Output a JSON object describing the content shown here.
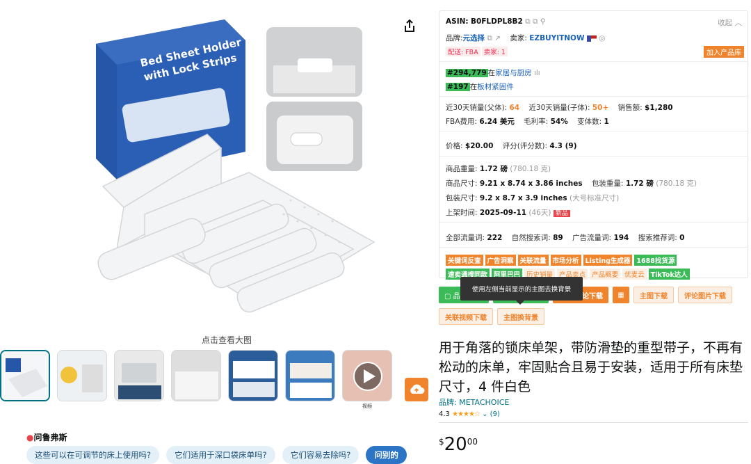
{
  "share_icon": "share-icon",
  "enlarge_text": "点击查看大图",
  "main_image": {
    "box_line1": "Bed Sheet Holder",
    "box_line2": "with Lock Strips"
  },
  "thumbs": [
    {
      "name": "thumb-1"
    },
    {
      "name": "thumb-2"
    },
    {
      "name": "thumb-3"
    },
    {
      "name": "thumb-4"
    },
    {
      "name": "thumb-5"
    },
    {
      "name": "thumb-6"
    },
    {
      "name": "thumb-7"
    }
  ],
  "video_label": "视频",
  "ask": {
    "title": "问鲁弗斯",
    "questions": [
      "这些可以在可调节的床上使用吗?",
      "它们适用于深口袋床单吗?",
      "它们容易去除吗?",
      "问别的"
    ]
  },
  "panel": {
    "asin_label": "ASIN:",
    "asin": "B0FLDPL8B2",
    "collapse": "收起",
    "brand_label": "品牌:",
    "brand": "元选择",
    "seller_label": "卖家:",
    "seller": "EZBUYITNOW",
    "ship_tags": [
      "配送: FBA",
      "卖家: 1"
    ],
    "add_btn": "加入产品库",
    "rank1": "#294,779",
    "rank1_cat_prefix": "在",
    "rank1_cat": "家居与厨房",
    "rank2": "#197",
    "rank2_cat_prefix": "在",
    "rank2_cat": "板材紧固件",
    "sales_parent_label": "近30天销量(父体):",
    "sales_parent": "64",
    "sales_child_label": "近30天销量(子体):",
    "sales_child": "50+",
    "revenue_label": "销售额:",
    "revenue": "$1,280",
    "fba_label": "FBA费用:",
    "fba": "6.24 美元",
    "margin_label": "毛利率:",
    "margin": "54%",
    "variants_label": "变体数:",
    "variants": "1",
    "price_label": "价格:",
    "price": "$20.00",
    "rating_label": "评分(评分数):",
    "rating": "4.3 (9)",
    "weight_label": "商品重量:",
    "weight": "1.72 磅",
    "weight_g": "(780.18 克)",
    "dims_label": "商品尺寸:",
    "dims": "9.21 x 8.74 x 3.86 inches",
    "pkg_weight_label": "包装重量:",
    "pkg_weight": "1.72 磅",
    "pkg_weight_g": "(780.18 克)",
    "pkg_dims_label": "包装尺寸:",
    "pkg_dims": "9.2 x 8.7 x 3.9 inches",
    "pkg_dims_note": "(大号标准尺寸)",
    "listed_label": "上架时间:",
    "listed": "2025-09-11",
    "listed_days": "(46天)",
    "new_tag": "新品",
    "kw_total_label": "全部流量词:",
    "kw_total": "222",
    "kw_org_label": "自然搜索词:",
    "kw_org": "89",
    "kw_ad_label": "广告流量词:",
    "kw_ad": "194",
    "kw_rec_label": "搜索推荐词:",
    "kw_rec": "0",
    "tools_row1": [
      "关键词反查",
      "广告洞察",
      "关联流量",
      "市场分析",
      "Listing生成器",
      "1688找货源"
    ],
    "tools_row2": [
      "速卖通搜同款",
      "阿里巴巴",
      "历史销量",
      "产品卖点",
      "产品概要",
      "优麦云",
      "TikTok达人"
    ]
  },
  "buttons": {
    "b1": "▢ 品",
    "b2": "",
    "b3": "论下载",
    "main_download": "主图下载",
    "review_img": "评论图片下载",
    "video_dl": "关联视频下载",
    "replace_bg": "主图换背景"
  },
  "tooltip": "使用左侧当前显示的主图去换背景",
  "product": {
    "title": "用于角落的锁床单架，带防滑垫的重型带子，不再有松动的床单，牢固贴合且易于安装，适用于所有床垫尺寸，4 件白色",
    "brand": "品牌: METACHOICE",
    "rating": "4.3",
    "rating_count": "(9)",
    "price_whole": "20",
    "price_frac": "00",
    "currency": "$"
  }
}
